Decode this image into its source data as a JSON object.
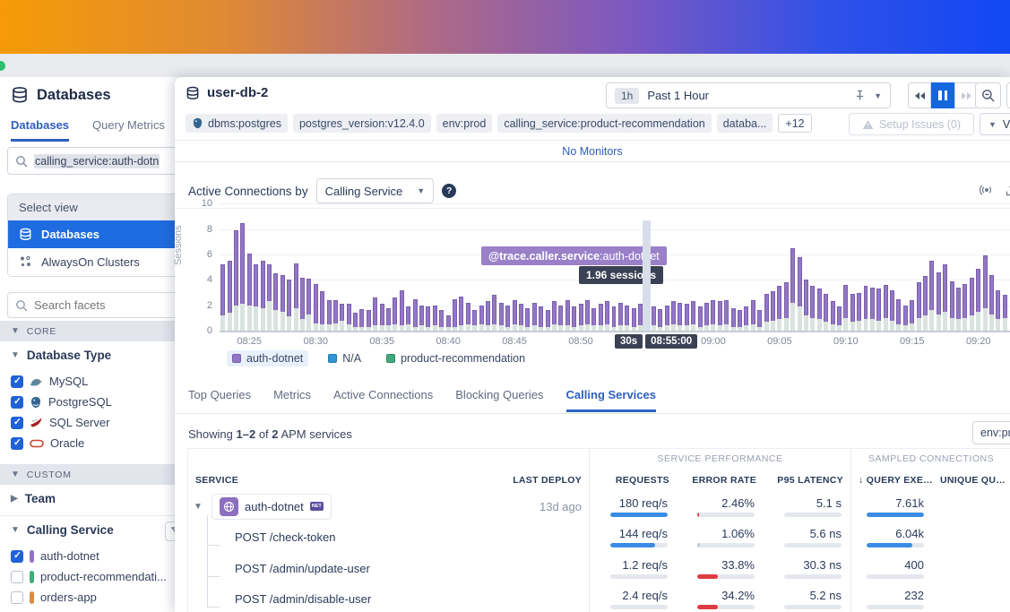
{
  "colors": {
    "accent_blue": "#2d5fbe",
    "selected_blue": "#1f6ce0",
    "pause_blue": "#1567dd",
    "bar_purple": "#9477c4",
    "bar_purple_border": "#7a5fae",
    "bar_base": "#dae3de",
    "bar_hover_pink": "#ef1f8c",
    "legend_blue": "#3095d6",
    "legend_green": "#44a97c",
    "req_bar_blue": "#3b8ce4",
    "error_bar_red": "#de3b40",
    "muted_bar_gray": "#c3c9d4"
  },
  "sidebar": {
    "title": "Databases",
    "tabs": [
      {
        "label": "Databases",
        "active": true
      },
      {
        "label": "Query Metrics",
        "active": false
      }
    ],
    "search_value": "calling_service:auth-dotn",
    "select_view": {
      "header": "Select view",
      "items": [
        {
          "label": "Databases",
          "selected": true,
          "icon": "database-icon"
        },
        {
          "label": "AlwaysOn Clusters",
          "selected": false,
          "icon": "cluster-icon"
        }
      ]
    },
    "facet_placeholder": "Search facets",
    "core_label": "CORE",
    "database_type": {
      "label": "Database Type",
      "options": [
        {
          "label": "MySQL",
          "checked": true,
          "icon": "mysql"
        },
        {
          "label": "PostgreSQL",
          "checked": true,
          "icon": "postgresql"
        },
        {
          "label": "SQL Server",
          "checked": true,
          "icon": "sqlserver"
        },
        {
          "label": "Oracle",
          "checked": true,
          "icon": "oracle"
        }
      ]
    },
    "custom_label": "CUSTOM",
    "team_label": "Team",
    "calling_service": {
      "label": "Calling Service",
      "options": [
        {
          "label": "auth-dotnet",
          "checked": true,
          "color": "#9472c8"
        },
        {
          "label": "product-recommendati...",
          "checked": false,
          "color": "#3fae77"
        },
        {
          "label": "orders-app",
          "checked": false,
          "color": "#e08a3c"
        }
      ]
    }
  },
  "header": {
    "title": "user-db-2",
    "time_range": {
      "badge": "1h",
      "label": "Past 1 Hour"
    },
    "tags": [
      {
        "text": "dbms:postgres",
        "icon": "postgres",
        "type": "tag"
      },
      {
        "text": "postgres_version:v12.4.0",
        "type": "tag"
      },
      {
        "text": "env:prod",
        "type": "tag"
      },
      {
        "text": "calling_service:product-recommendation",
        "type": "tag"
      },
      {
        "text": "databa...",
        "type": "tag"
      },
      {
        "text": "+12",
        "type": "more"
      }
    ],
    "setup_issues_label": "Setup Issues (0)",
    "view_button_label": "View P",
    "no_monitors_label": "No Monitors"
  },
  "chart": {
    "title_prefix": "Active Connections by",
    "breakdown_selected": "Calling Service",
    "ylabel": "Sessions",
    "tooltip": {
      "tag_bold": "@trace.caller.service",
      "tag_value": ":auth-dotnet",
      "sessions_label": "1.96 sessions",
      "interval_badge": "30s",
      "time_badge": "08:55:00"
    },
    "legend": [
      {
        "label": "auth-dotnet",
        "color": "#9477c4",
        "border": "#7a5fae",
        "highlighted": true
      },
      {
        "label": "N/A",
        "color": "#3095d6",
        "border": "#2379b4",
        "highlighted": false
      },
      {
        "label": "product-recommendation",
        "color": "#44a97c",
        "border": "#2e8a61",
        "highlighted": false
      }
    ]
  },
  "chart_data": {
    "type": "bar",
    "stacked": true,
    "title": "Active Connections by Calling Service",
    "ylabel": "Sessions",
    "ylim": [
      0,
      10
    ],
    "y_ticks": [
      0,
      2,
      4,
      6,
      8,
      10
    ],
    "bucket_seconds": 30,
    "start_time": "08:23",
    "hover_index": 64,
    "hover_value_sessions": 1.96,
    "x_ticks": [
      {
        "label": "08:25",
        "i": 4
      },
      {
        "label": "08:30",
        "i": 14
      },
      {
        "label": "08:35",
        "i": 24
      },
      {
        "label": "08:40",
        "i": 34
      },
      {
        "label": "08:45",
        "i": 44
      },
      {
        "label": "08:50",
        "i": 54
      },
      {
        "label": "08:55",
        "i": 64
      },
      {
        "label": "09:00",
        "i": 74
      },
      {
        "label": "09:05",
        "i": 84
      },
      {
        "label": "09:10",
        "i": 94
      },
      {
        "label": "09:15",
        "i": 104
      },
      {
        "label": "09:20",
        "i": 114
      }
    ],
    "series_note": "bars = [total_sessions, other_services_base]; auth-dotnet = total - base",
    "bars": [
      [
        5.2,
        1.2
      ],
      [
        5.5,
        1.4
      ],
      [
        7.9,
        2.0
      ],
      [
        8.5,
        2.1
      ],
      [
        6.1,
        2.0
      ],
      [
        5.2,
        1.9
      ],
      [
        5.5,
        1.8
      ],
      [
        5.2,
        2.3
      ],
      [
        4.5,
        1.6
      ],
      [
        4.4,
        1.5
      ],
      [
        4.0,
        1.1
      ],
      [
        5.3,
        1.8
      ],
      [
        4.2,
        0.9
      ],
      [
        4.1,
        1.3
      ],
      [
        3.7,
        0.6
      ],
      [
        3.1,
        0.5
      ],
      [
        2.4,
        0.5
      ],
      [
        2.4,
        0.6
      ],
      [
        2.1,
        0.8
      ],
      [
        2.1,
        0.5
      ],
      [
        1.4,
        0.3
      ],
      [
        1.7,
        0.3
      ],
      [
        1.6,
        0.3
      ],
      [
        2.6,
        0.4
      ],
      [
        2.1,
        0.4
      ],
      [
        1.8,
        0.4
      ],
      [
        2.6,
        0.5
      ],
      [
        3.2,
        0.4
      ],
      [
        1.9,
        0.5
      ],
      [
        2.5,
        0.3
      ],
      [
        2.0,
        0.4
      ],
      [
        1.9,
        0.3
      ],
      [
        2.0,
        0.4
      ],
      [
        1.6,
        0.3
      ],
      [
        1.2,
        0.3
      ],
      [
        2.5,
        0.3
      ],
      [
        2.7,
        0.4
      ],
      [
        2.2,
        0.5
      ],
      [
        1.6,
        0.4
      ],
      [
        2.0,
        0.5
      ],
      [
        2.3,
        0.4
      ],
      [
        2.8,
        0.5
      ],
      [
        2.2,
        0.4
      ],
      [
        2.0,
        0.3
      ],
      [
        2.4,
        0.5
      ],
      [
        2.1,
        0.4
      ],
      [
        1.8,
        0.3
      ],
      [
        2.2,
        0.4
      ],
      [
        1.9,
        0.3
      ],
      [
        1.6,
        0.3
      ],
      [
        2.3,
        0.5
      ],
      [
        2.0,
        0.4
      ],
      [
        2.4,
        0.4
      ],
      [
        1.9,
        0.3
      ],
      [
        2.1,
        0.4
      ],
      [
        2.4,
        0.5
      ],
      [
        1.8,
        0.4
      ],
      [
        2.1,
        0.4
      ],
      [
        2.3,
        0.5
      ],
      [
        1.9,
        0.3
      ],
      [
        2.2,
        0.4
      ],
      [
        2.0,
        0.4
      ],
      [
        1.8,
        0.3
      ],
      [
        2.1,
        0.4
      ],
      [
        2.7,
        0.74
      ],
      [
        1.9,
        0.4
      ],
      [
        1.7,
        0.3
      ],
      [
        2.0,
        0.4
      ],
      [
        2.3,
        0.5
      ],
      [
        2.2,
        0.4
      ],
      [
        2.1,
        0.4
      ],
      [
        2.3,
        0.5
      ],
      [
        1.9,
        0.3
      ],
      [
        2.2,
        0.4
      ],
      [
        2.4,
        0.5
      ],
      [
        2.3,
        0.4
      ],
      [
        2.4,
        0.5
      ],
      [
        1.8,
        0.3
      ],
      [
        1.6,
        0.3
      ],
      [
        1.9,
        0.4
      ],
      [
        2.4,
        0.5
      ],
      [
        1.6,
        0.3
      ],
      [
        2.9,
        0.7
      ],
      [
        3.1,
        0.8
      ],
      [
        3.5,
        0.9
      ],
      [
        3.8,
        1.0
      ],
      [
        6.5,
        2.2
      ],
      [
        5.8,
        1.9
      ],
      [
        4.0,
        1.2
      ],
      [
        3.5,
        1.0
      ],
      [
        3.3,
        0.9
      ],
      [
        2.9,
        0.7
      ],
      [
        2.3,
        0.5
      ],
      [
        1.9,
        0.4
      ],
      [
        3.6,
        1.0
      ],
      [
        2.9,
        0.7
      ],
      [
        3.0,
        0.8
      ],
      [
        3.5,
        0.9
      ],
      [
        3.4,
        0.9
      ],
      [
        3.3,
        0.8
      ],
      [
        3.6,
        1.0
      ],
      [
        3.2,
        0.8
      ],
      [
        2.5,
        0.5
      ],
      [
        2.0,
        0.4
      ],
      [
        2.4,
        0.6
      ],
      [
        3.8,
        1.0
      ],
      [
        4.3,
        1.2
      ],
      [
        5.5,
        1.6
      ],
      [
        4.6,
        1.3
      ],
      [
        5.2,
        1.5
      ],
      [
        3.9,
        1.0
      ],
      [
        3.4,
        0.9
      ],
      [
        3.7,
        1.0
      ],
      [
        4.2,
        1.2
      ],
      [
        4.9,
        1.5
      ],
      [
        5.9,
        1.8
      ],
      [
        4.4,
        1.3
      ],
      [
        3.2,
        0.9
      ],
      [
        2.8,
        1.0
      ]
    ]
  },
  "tabs": {
    "items": [
      "Top Queries",
      "Metrics",
      "Active Connections",
      "Blocking Queries",
      "Calling Services"
    ],
    "active": "Calling Services"
  },
  "summary": {
    "prefix": "Showing",
    "range": "1–2",
    "of": "of",
    "total": "2",
    "suffix": "APM services"
  },
  "env_filter_value": "env:pro",
  "table": {
    "group_performance": "SERVICE PERFORMANCE",
    "group_sampled": "SAMPLED CONNECTIONS",
    "columns": {
      "service": "SERVICE",
      "last_deploy": "LAST DEPLOY",
      "requests": "REQUESTS",
      "error_rate": "ERROR RATE",
      "p95": "P95 LATENCY",
      "query_exec": "QUERY EXE…",
      "unique": "UNIQUE QU…"
    },
    "sort": {
      "column": "query_exec",
      "direction": "desc",
      "glyph": "↓"
    },
    "rows": [
      {
        "type": "service",
        "name": "auth-dotnet",
        "badge": "NET",
        "last_deploy": "13d ago",
        "requests": "180 req/s",
        "requests_pct": 100,
        "error_rate": "2.46%",
        "error_pct": 3,
        "error_color": "red",
        "p95": "5.1 s",
        "p95_pct": 0,
        "query_exec": "7.61k",
        "query_pct": 100
      },
      {
        "type": "endpoint",
        "name": "POST /check-token",
        "last_deploy": "",
        "requests": "144 req/s",
        "requests_pct": 78,
        "error_rate": "1.06%",
        "error_pct": 4,
        "error_color": "gray",
        "p95": "5.6 ns",
        "p95_pct": 0,
        "query_exec": "6.04k",
        "query_pct": 79
      },
      {
        "type": "endpoint",
        "name": "POST /admin/update-user",
        "last_deploy": "",
        "requests": "1.2 req/s",
        "requests_pct": 0,
        "error_rate": "33.8%",
        "error_pct": 36,
        "error_color": "red",
        "p95": "30.3 ns",
        "p95_pct": 0,
        "query_exec": "400",
        "query_pct": 0
      },
      {
        "type": "endpoint",
        "name": "POST /admin/disable-user",
        "last_deploy": "",
        "requests": "2.4 req/s",
        "requests_pct": 0,
        "error_rate": "34.2%",
        "error_pct": 36,
        "error_color": "red",
        "p95": "5.2 ns",
        "p95_pct": 0,
        "query_exec": "232",
        "query_pct": 0
      }
    ]
  }
}
